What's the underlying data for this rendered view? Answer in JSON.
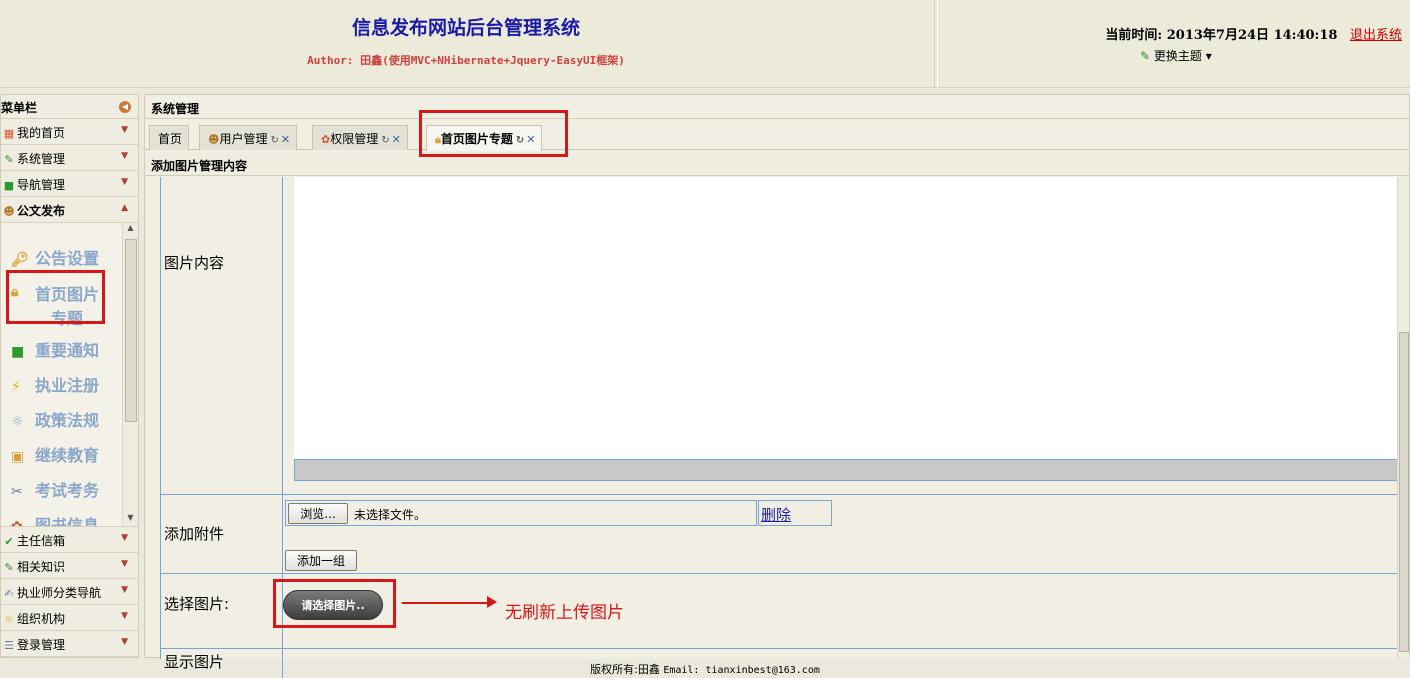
{
  "header": {
    "title": "信息发布网站后台管理系统",
    "author": "Author: 田鑫(使用MVC+NHibernate+Jquery-EasyUI框架)",
    "time_label": "当前时间:",
    "time_value": "2013年7月24日  14:40:18",
    "logout": "退出系统",
    "theme": "更换主题"
  },
  "sidebar": {
    "title": "菜单栏",
    "items": [
      {
        "label": "我的首页",
        "icon": "grid-icon"
      },
      {
        "label": "系统管理",
        "icon": "pencil-icon"
      },
      {
        "label": "导航管理",
        "icon": "green-box-icon"
      },
      {
        "label": "公文发布",
        "icon": "users-icon"
      },
      {
        "label": "主任信箱",
        "icon": "check-icon"
      },
      {
        "label": "相关知识",
        "icon": "pencil-icon"
      },
      {
        "label": "执业师分类导航",
        "icon": "edit-icon"
      },
      {
        "label": "组织机构",
        "icon": "bulb-icon"
      },
      {
        "label": "登录管理",
        "icon": "list-icon"
      }
    ],
    "submenu": [
      {
        "line1": "公告设置",
        "line2": ""
      },
      {
        "line1": "首页图片",
        "line2": "专题"
      },
      {
        "line1": "重要通知",
        "line2": ""
      },
      {
        "line1": "执业注册",
        "line2": ""
      },
      {
        "line1": "政策法规",
        "line2": ""
      },
      {
        "line1": "继续教育",
        "line2": ""
      },
      {
        "line1": "考试考务",
        "line2": ""
      },
      {
        "line1": "图书信息",
        "line2": ""
      }
    ]
  },
  "main": {
    "title": "系统管理",
    "tabs": [
      {
        "label": "首页"
      },
      {
        "label": "用户管理"
      },
      {
        "label": "权限管理"
      },
      {
        "label": "首页图片专题"
      }
    ],
    "content_title": "添加图片管理内容"
  },
  "form": {
    "content_label": "图片内容",
    "attach_label": "添加附件",
    "browse_btn": "浏览...",
    "file_status": "未选择文件。",
    "delete_link": "删除",
    "add_group_btn": "添加一组",
    "choose_label": "选择图片:",
    "choose_btn": "请选择图片..",
    "show_label": "显示图片"
  },
  "annotation": "无刷新上传图片",
  "footer": {
    "copyright": "版权所有:田鑫 ",
    "email": "Email: tianxinbest@163.com"
  },
  "colors": {
    "title": "#1a1aa8",
    "author": "#d04040",
    "highlight": "#d81818",
    "link": "#1b1bb0"
  }
}
